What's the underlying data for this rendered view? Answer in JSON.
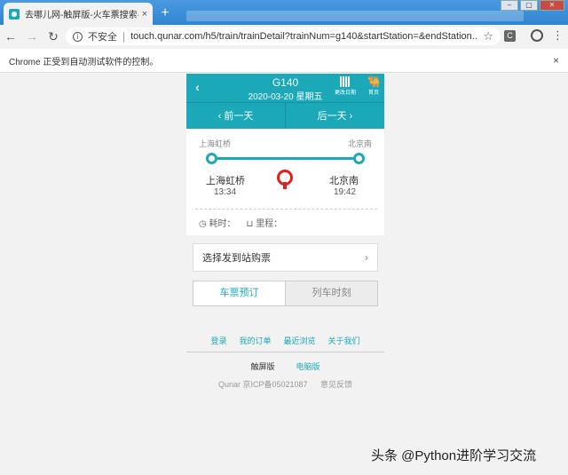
{
  "browser": {
    "tab_title": "去哪儿网-触屏版-火车票搜索-车",
    "tab_close": "×",
    "new_tab": "+",
    "insecure_label": "不安全",
    "url": "touch.qunar.com/h5/train/trainDetail?trainNum=g140&startStation=&endStation...",
    "automation_notice": "Chrome 正受到自动测试软件的控制。",
    "infobar_close": "×"
  },
  "header": {
    "back": "‹",
    "train_number": "G140",
    "date": "2020-03-20 星期五",
    "change_date_label": "更改日期",
    "home_label": "首页"
  },
  "daynav": {
    "prev": "前一天",
    "next": "后一天"
  },
  "route": {
    "from_small": "上海虹桥",
    "to_small": "北京南",
    "from_name": "上海虹桥",
    "from_time": "13:34",
    "to_name": "北京南",
    "to_time": "19:42",
    "duration_label": "耗时：",
    "distance_label": "里程："
  },
  "select_station": "选择发到站购票",
  "tabs": {
    "booking": "车票预订",
    "schedule": "列车时刻"
  },
  "links": [
    "登录",
    "我的订单",
    "最近浏览",
    "关于我们"
  ],
  "versions": {
    "touch": "触屏版",
    "pc": "电脑版"
  },
  "footer": {
    "icp": "Qunar 京ICP备05021087",
    "feedback": "意见反馈"
  },
  "watermark": "头条 @Python进阶学习交流",
  "colors": {
    "accent": "#1ba9ba",
    "rail_red": "#e02020"
  }
}
